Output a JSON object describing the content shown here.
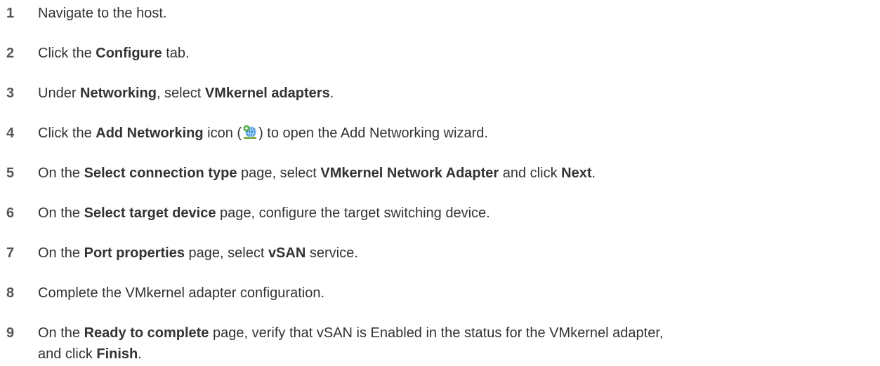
{
  "steps": [
    {
      "number": "1",
      "text": "Navigate to the host."
    },
    {
      "number": "2",
      "t1": "Click the ",
      "b1": "Configure",
      "t2": " tab."
    },
    {
      "number": "3",
      "t1": "Under ",
      "b1": "Networking",
      "t2": ", select ",
      "b2": "VMkernel adapters",
      "t3": "."
    },
    {
      "number": "4",
      "t1": "Click the ",
      "b1": "Add Networking",
      "t2": " icon (",
      "icon": "add-networking-icon",
      "t3": ") to open the Add Networking wizard."
    },
    {
      "number": "5",
      "t1": "On the ",
      "b1": "Select connection type",
      "t2": " page, select ",
      "b2": "VMkernel Network Adapter",
      "t3": " and click ",
      "b3": "Next",
      "t4": "."
    },
    {
      "number": "6",
      "t1": "On the ",
      "b1": "Select target device",
      "t2": " page, configure the target switching device."
    },
    {
      "number": "7",
      "t1": "On the ",
      "b1": "Port properties",
      "t2": " page, select ",
      "b2": "vSAN",
      "t3": " service."
    },
    {
      "number": "8",
      "text": "Complete the VMkernel adapter configuration."
    },
    {
      "number": "9",
      "t1": "On the ",
      "b1": "Ready to complete",
      "t2": " page, verify that vSAN is Enabled in the status for the VMkernel adapter,",
      "t3": "and click ",
      "b2": "Finish",
      "t4": "."
    }
  ]
}
